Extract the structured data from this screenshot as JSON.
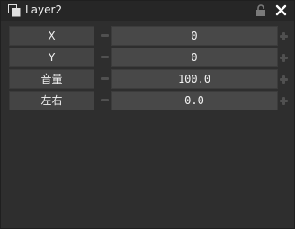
{
  "panel": {
    "title": "Layer2",
    "icons": {
      "title": "layers-icon",
      "lock": "lock-icon",
      "close": "close-icon"
    }
  },
  "rows": [
    {
      "label": "X",
      "value": "0"
    },
    {
      "label": "Y",
      "value": "0"
    },
    {
      "label": "音量",
      "value": "100.0"
    },
    {
      "label": "左右",
      "value": "0.0"
    }
  ],
  "colors": {
    "background": "#2e2e2e",
    "titlebar": "#262626",
    "label_bg": "#444444",
    "field_bg": "#484848",
    "stepper": "#505050"
  }
}
